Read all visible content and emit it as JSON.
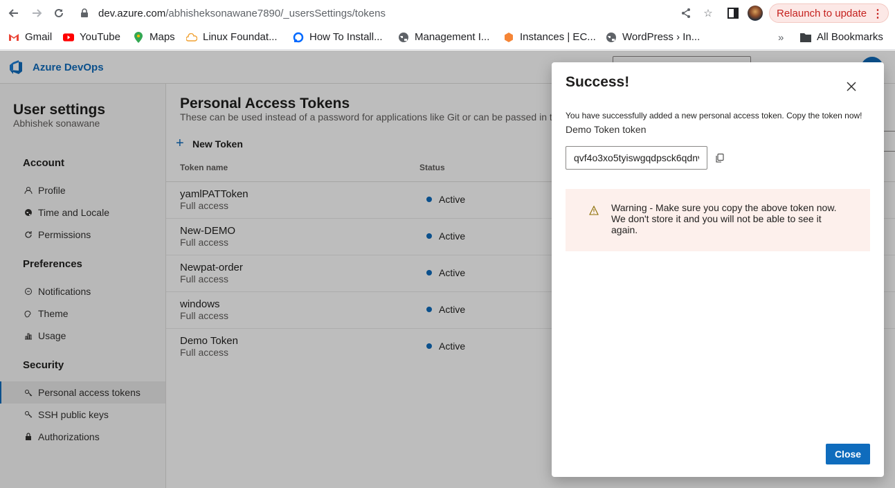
{
  "browser": {
    "url_host": "dev.azure.com",
    "url_path": "/abhisheksonawane7890/_usersSettings/tokens",
    "relaunch_label": "Relaunch to update",
    "bookmarks": [
      {
        "label": "Gmail",
        "icon": "gmail-icon",
        "color": "#ea4335"
      },
      {
        "label": "YouTube",
        "icon": "youtube-icon",
        "color": "#ff0000"
      },
      {
        "label": "Maps",
        "icon": "maps-icon",
        "color": "#34a853"
      },
      {
        "label": "Linux Foundat...",
        "icon": "linux-foundation-icon",
        "color": "#f0a030"
      },
      {
        "label": "How To Install...",
        "icon": "digitalocean-icon",
        "color": "#0069ff"
      },
      {
        "label": "Management I...",
        "icon": "globe-icon",
        "color": "#5f6368"
      },
      {
        "label": "Instances | EC...",
        "icon": "aws-icon",
        "color": "#f58536"
      },
      {
        "label": "WordPress › In...",
        "icon": "globe-icon",
        "color": "#5f6368"
      }
    ],
    "all_bookmarks_label": "All Bookmarks"
  },
  "app": {
    "name": "Azure DevOps",
    "accent": "#0f6cbd"
  },
  "sidebar": {
    "title": "User settings",
    "user": "Abhishek sonawane",
    "sections": [
      {
        "heading": "Account",
        "items": [
          {
            "label": "Profile",
            "icon": "profile-icon"
          },
          {
            "label": "Time and Locale",
            "icon": "globe-icon"
          },
          {
            "label": "Permissions",
            "icon": "permissions-icon"
          }
        ]
      },
      {
        "heading": "Preferences",
        "items": [
          {
            "label": "Notifications",
            "icon": "notifications-icon"
          },
          {
            "label": "Theme",
            "icon": "theme-icon"
          },
          {
            "label": "Usage",
            "icon": "usage-icon"
          }
        ]
      },
      {
        "heading": "Security",
        "items": [
          {
            "label": "Personal access tokens",
            "icon": "key-icon",
            "selected": true
          },
          {
            "label": "SSH public keys",
            "icon": "ssh-key-icon"
          },
          {
            "label": "Authorizations",
            "icon": "lock-icon"
          }
        ]
      }
    ]
  },
  "main": {
    "title": "Personal Access Tokens",
    "description": "These can be used instead of a password for applications like Git or can be passed in t",
    "new_token_label": "New Token",
    "columns": [
      "Token name",
      "Status"
    ],
    "tokens": [
      {
        "name": "yamlPATToken",
        "scope": "Full access",
        "status": "Active"
      },
      {
        "name": "New-DEMO",
        "scope": "Full access",
        "status": "Active"
      },
      {
        "name": "Newpat-order",
        "scope": "Full access",
        "status": "Active"
      },
      {
        "name": "windows",
        "scope": "Full access",
        "status": "Active"
      },
      {
        "name": "Demo Token",
        "scope": "Full access",
        "status": "Active"
      }
    ]
  },
  "dialog": {
    "title": "Success!",
    "message": "You have successfully added a new personal access token. Copy the token now!",
    "token_label": "Demo Token token",
    "token_value": "qvf4o3xo5tyiswgqdpsck6qdnv",
    "warning": "Warning - Make sure you copy the above token now. We don't store it and you will not be able to see it again.",
    "close_label": "Close"
  }
}
